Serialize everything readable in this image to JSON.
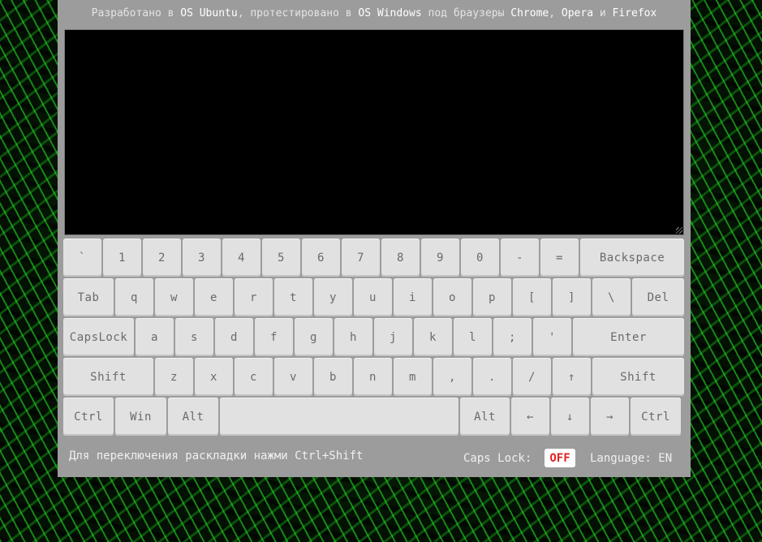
{
  "header": {
    "p1": "Разработано в ",
    "os1": "OS Ubuntu",
    "p2": ", протестировано в ",
    "os2": "OS Windows",
    "p3": " под браузеры ",
    "b1": "Chrome",
    "p4": ", ",
    "b2": "Opera",
    "p5": " и ",
    "b3": "Firefox"
  },
  "screen": {
    "value": ""
  },
  "keyboard": {
    "row1": [
      "`",
      "1",
      "2",
      "3",
      "4",
      "5",
      "6",
      "7",
      "8",
      "9",
      "0",
      "-",
      "=",
      "Backspace"
    ],
    "row2": [
      "Tab",
      "q",
      "w",
      "e",
      "r",
      "t",
      "y",
      "u",
      "i",
      "o",
      "p",
      "[",
      "]",
      "\\",
      "Del"
    ],
    "row3": [
      "CapsLock",
      "a",
      "s",
      "d",
      "f",
      "g",
      "h",
      "j",
      "k",
      "l",
      ";",
      "'",
      "Enter"
    ],
    "row4": [
      "Shift",
      "z",
      "x",
      "c",
      "v",
      "b",
      "n",
      "m",
      ",",
      ".",
      "/",
      "↑",
      "Shift"
    ],
    "row5": [
      "Ctrl",
      "Win",
      "Alt",
      "",
      "Alt",
      "←",
      "↓",
      "→",
      "Ctrl"
    ]
  },
  "footer": {
    "hint": "Для переключения раскладки нажми Ctrl+Shift",
    "caps_label": "Caps Lock:",
    "caps_state": "OFF",
    "language": "Language: EN"
  },
  "colors": {
    "caps_off": "#e02222",
    "panel": "#9c9c9c",
    "key": "#e1e1e1"
  }
}
